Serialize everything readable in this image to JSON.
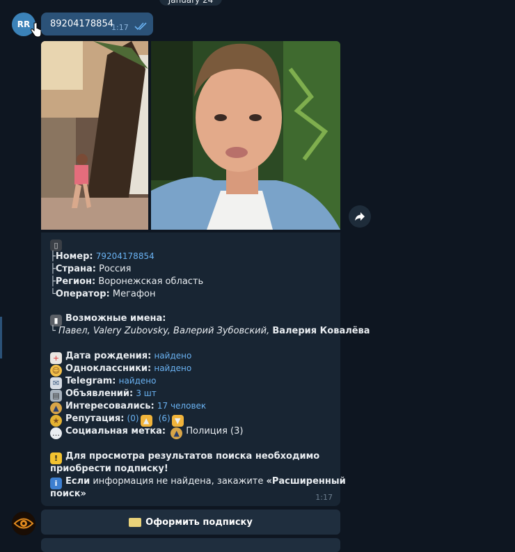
{
  "date_separator": "January 24",
  "user": {
    "avatar_initials": "RR"
  },
  "query_message": {
    "text": "89204178854",
    "time": "1:17"
  },
  "result": {
    "header_icon": "mobile-phone-icon",
    "number_label": "Номер:",
    "number_value": "79204178854",
    "country_label": "Страна:",
    "country_value": "Россия",
    "region_label": "Регион:",
    "region_value": "Воронежская область",
    "operator_label": "Оператор:",
    "operator_value": "Мегафон",
    "names_title": "Возможные имена:",
    "names_list": "Павел, Valery Zubovsky, Валерий Зубовский,",
    "names_bold": "Валерия  Ковалёва",
    "birth_label": "Дата рождения:",
    "birth_value": "найдено",
    "classmates_label": "Одноклассники:",
    "classmates_value": "найдено",
    "telegram_label": "Telegram:",
    "telegram_value": "найдено",
    "ads_label": "Объявлений:",
    "ads_value": "3  шт",
    "interested_label": "Интересовались:",
    "interested_value": "17  человек",
    "reputation_label": "Репутация:",
    "rep_pos": "(0)",
    "rep_neg": "(6)",
    "social_label": "Социальная метка:",
    "social_value": "Полиция (3)",
    "warning_text": "Для просмотра результатов поиска необходимо",
    "warning_text2": "приобрести подписку!",
    "info_pre": "Если",
    "info_mid": " информация не найдена, закажите ",
    "info_bold": "«Расширенный",
    "info_bold2": "поиск»",
    "time": "1:17"
  },
  "buttons": {
    "subscribe_label": "Оформить подписку"
  },
  "colors": {
    "background": "#0e1621",
    "outgoing": "#2b5278",
    "incoming": "#182533",
    "link": "#6ab2f2"
  }
}
